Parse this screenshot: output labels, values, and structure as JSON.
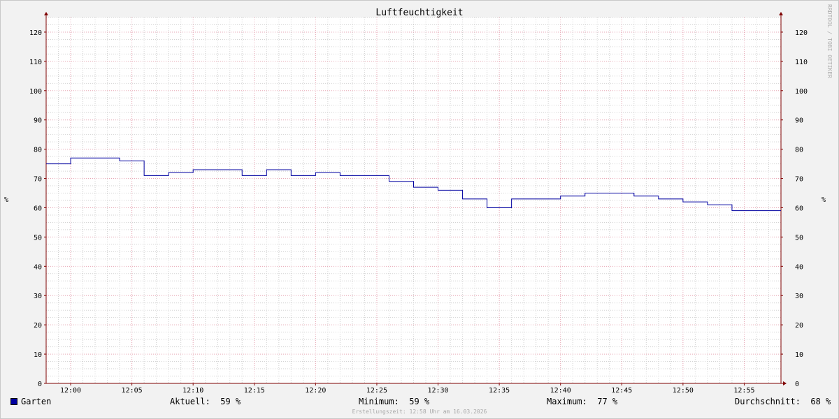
{
  "chart_data": {
    "type": "line",
    "title": "Luftfeuchtigkeit",
    "ylabel": "%",
    "ylim": [
      0,
      125
    ],
    "yticks": [
      0,
      10,
      20,
      30,
      40,
      50,
      60,
      70,
      80,
      90,
      100,
      110,
      120
    ],
    "xlim": [
      "11:58",
      "12:58"
    ],
    "x_tick_labels": [
      "12:00",
      "12:05",
      "12:10",
      "12:15",
      "12:20",
      "12:25",
      "12:30",
      "12:35",
      "12:40",
      "12:45",
      "12:50",
      "12:55"
    ],
    "grid": true,
    "series": [
      {
        "name": "Garten",
        "color": "#0000a0",
        "step": true,
        "x": [
          "11:58",
          "12:00",
          "12:04",
          "12:06",
          "12:08",
          "12:10",
          "12:14",
          "12:16",
          "12:18",
          "12:20",
          "12:22",
          "12:26",
          "12:28",
          "12:30",
          "12:32",
          "12:34",
          "12:36",
          "12:38",
          "12:40",
          "12:42",
          "12:46",
          "12:48",
          "12:50",
          "12:52",
          "12:54"
        ],
        "values": [
          75,
          77,
          76,
          71,
          72,
          73,
          71,
          73,
          71,
          72,
          71,
          69,
          67,
          66,
          63,
          60,
          63,
          63,
          64,
          65,
          64,
          63,
          62,
          61,
          59
        ],
        "end_x": "12:58"
      }
    ]
  },
  "legend": {
    "series_name": "Garten",
    "current_label": "Aktuell:",
    "current_value": "59 %",
    "min_label": "Minimum:",
    "min_value": "59 %",
    "max_label": "Maximum:",
    "max_value": "77 %",
    "avg_label": "Durchschnitt:",
    "avg_value": "68 %"
  },
  "footer": "Erstellungszeit: 12:58 Uhr am 16.03.2026",
  "watermark": "RRDTOOL / TOBI OETIKER",
  "colors": {
    "background": "#f2f2f2",
    "plot_background": "#ffffff",
    "major_grid": "#e7a6b4",
    "minor_grid": "#d2d2d2",
    "axis": "#7f0000",
    "series": "#0000a0"
  }
}
